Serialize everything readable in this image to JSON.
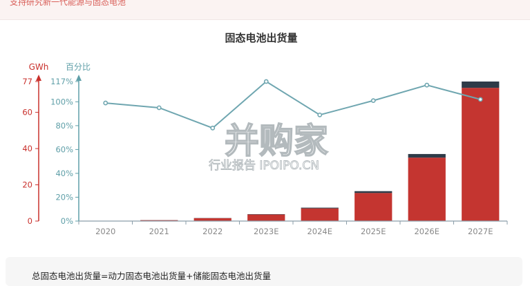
{
  "banner": {
    "text": "支持研究新一代能源与固态电池"
  },
  "colors": {
    "bar_main": "#c43530",
    "bar_top": "#2f3b48",
    "line": "#6fa6b0",
    "left_axis": "#c9302c",
    "right_axis": "#5f9fa8",
    "x_axis": "#8b9ea9",
    "title": "#333333"
  },
  "watermark": {
    "main": "并购家",
    "sub": "行业报告 IPOIPO.CN"
  },
  "chart_data": {
    "type": "bar",
    "title": "固态电池出货量",
    "categories": [
      "2020",
      "2021",
      "2022",
      "2023E",
      "2024E",
      "2025E",
      "2026E",
      "2027E"
    ],
    "y_left": {
      "label": "GWh",
      "ticks": [
        "0",
        "20",
        "40",
        "60",
        "77"
      ],
      "range": [
        0,
        77
      ]
    },
    "y_right": {
      "label": "百分比",
      "ticks": [
        "0%",
        "20%",
        "40%",
        "60%",
        "80%",
        "100%",
        "117%"
      ],
      "range": [
        0,
        117
      ]
    },
    "series": [
      {
        "kind": "bar",
        "axis": "left",
        "color_key": "bar_main",
        "values": [
          0.1,
          0.5,
          1.6,
          3.6,
          7.0,
          15.5,
          35.0,
          73.5
        ]
      },
      {
        "kind": "bar",
        "axis": "left",
        "color_key": "bar_top",
        "values": [
          0,
          0.05,
          0.1,
          0.2,
          0.4,
          1.0,
          2.0,
          3.5
        ]
      },
      {
        "kind": "line",
        "axis": "right",
        "color_key": "line",
        "values": [
          99,
          95,
          78,
          117,
          89,
          101,
          114,
          102
        ]
      }
    ]
  },
  "note": {
    "formula": "总固态电池出货量=动力固态电池出货量+储能固态电池出货量"
  }
}
